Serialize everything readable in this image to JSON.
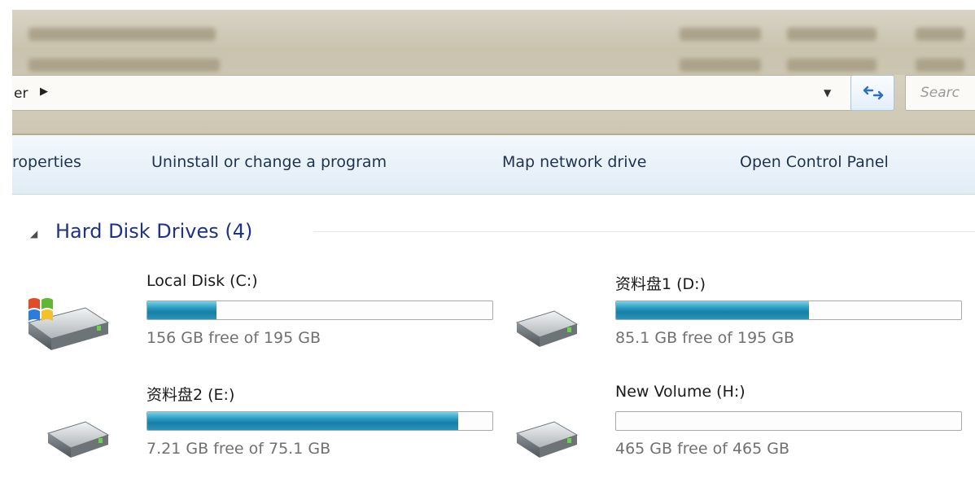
{
  "address": {
    "crumb": "er",
    "search_placeholder": "Searc"
  },
  "toolbar": {
    "commands": [
      {
        "label": "roperties"
      },
      {
        "label": "Uninstall or change a program"
      },
      {
        "label": "Map network drive"
      },
      {
        "label": "Open Control Panel"
      }
    ]
  },
  "group": {
    "title": "Hard Disk Drives (4)"
  },
  "drives": [
    {
      "name": "Local Disk (C:)",
      "free_text": "156 GB free of 195 GB",
      "used_fraction": 0.2,
      "icon": "windows-system-drive-icon"
    },
    {
      "name": "资料盘1 (D:)",
      "free_text": "85.1 GB free of 195 GB",
      "used_fraction": 0.56,
      "icon": "hard-drive-icon"
    },
    {
      "name": "资料盘2 (E:)",
      "free_text": "7.21 GB free of 75.1 GB",
      "used_fraction": 0.9,
      "icon": "hard-drive-icon"
    },
    {
      "name": "New Volume (H:)",
      "free_text": "465 GB free of 465 GB",
      "used_fraction": 0.0,
      "icon": "hard-drive-icon"
    }
  ],
  "colors": {
    "usage_bar": "#2196be",
    "group_title": "#1e3287"
  }
}
